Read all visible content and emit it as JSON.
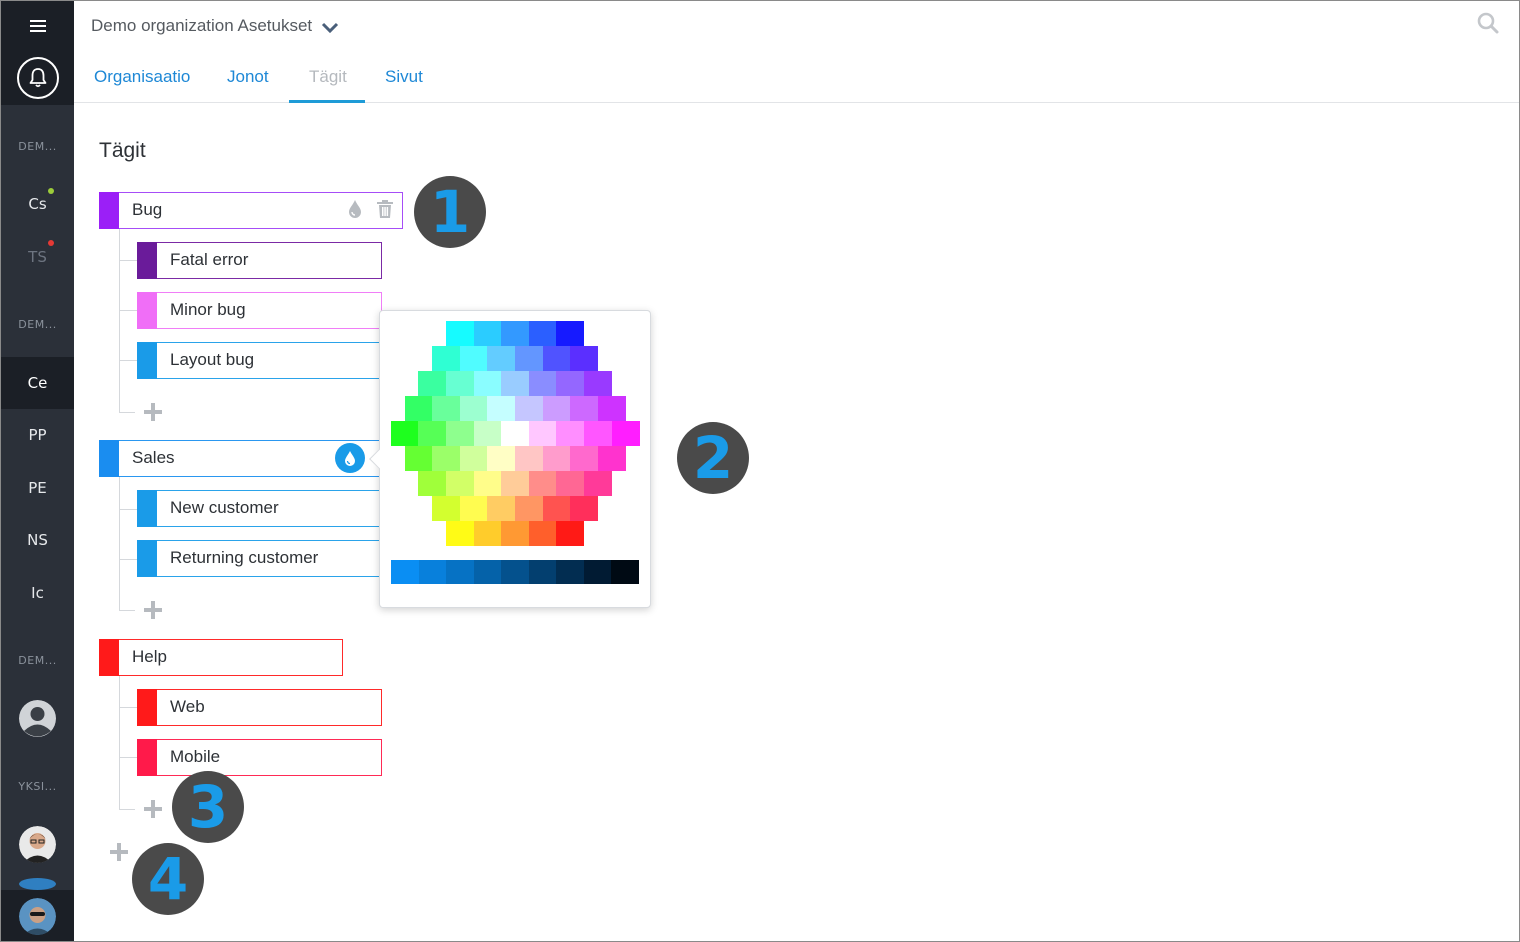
{
  "header": {
    "title": "Demo organization Asetukset"
  },
  "tabs": [
    {
      "label": "Organisaatio",
      "active": false
    },
    {
      "label": "Jonot",
      "active": false
    },
    {
      "label": "Tägit",
      "active": true
    },
    {
      "label": "Sivut",
      "active": false
    }
  ],
  "sidebar": {
    "sections": [
      "DEM...",
      "DEM...",
      "DEM...",
      "YKSI..."
    ],
    "items": [
      {
        "label": "Cs",
        "dot": "#9ccc3a"
      },
      {
        "label": "TS",
        "dot": "#e53935"
      },
      {
        "label": "Ce"
      },
      {
        "label": "PP"
      },
      {
        "label": "PE"
      },
      {
        "label": "NS"
      },
      {
        "label": "Ic"
      }
    ]
  },
  "page": {
    "title": "Tägit"
  },
  "tags": [
    {
      "label": "Bug",
      "color": "#9b1ff7",
      "children": [
        {
          "label": "Fatal error",
          "color": "#6a1b9a"
        },
        {
          "label": "Minor bug",
          "color": "#f06ef7"
        },
        {
          "label": "Layout bug",
          "color": "#1a9be8"
        }
      ]
    },
    {
      "label": "Sales",
      "color": "#1a8df0",
      "children": [
        {
          "label": "New customer",
          "color": "#1a9be8"
        },
        {
          "label": "Returning customer",
          "color": "#1a9be8"
        }
      ]
    },
    {
      "label": "Help",
      "color": "#ff1a1a",
      "children": [
        {
          "label": "Web",
          "color": "#ff1a1a"
        },
        {
          "label": "Mobile",
          "color": "#ff1a4a"
        }
      ]
    }
  ],
  "callouts": [
    "1",
    "2",
    "3",
    "4"
  ],
  "colors": {
    "accent": "#1e88d6",
    "sidebar": "#2b3039",
    "sidebar_dark": "#1b1f26",
    "callout_bg": "#4a4a4a",
    "callout_fg": "#1a9be8"
  }
}
